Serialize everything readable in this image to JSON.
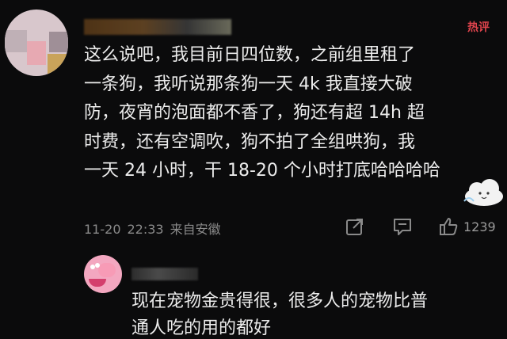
{
  "comment": {
    "hot_label": "热评",
    "text_lines": [
      "这么说吧，我目前日四位数，之前组里租了",
      "一条狗，我听说那条狗一天 4k 我直接大破",
      "防，夜宵的泡面都不香了，狗还有超 14h 超",
      "时费，还有空调吹，狗不拍了全组哄狗，我",
      "一天 24 小时，干 18-20 个小时打底哈哈哈哈"
    ],
    "date": "11-20",
    "time": "22:33",
    "location": "来自安徽",
    "like_count": "1239",
    "icons": {
      "share": "share-icon",
      "comment": "comment-icon",
      "like": "thumbs-up-icon"
    }
  },
  "reply": {
    "text_lines": [
      "现在宠物金贵得很，很多人的宠物比普",
      "通人吃的用的都好"
    ]
  },
  "colors": {
    "background": "#0b0b0c",
    "text": "#ececec",
    "meta": "#8a8a8a",
    "hot": "#e0444d"
  }
}
